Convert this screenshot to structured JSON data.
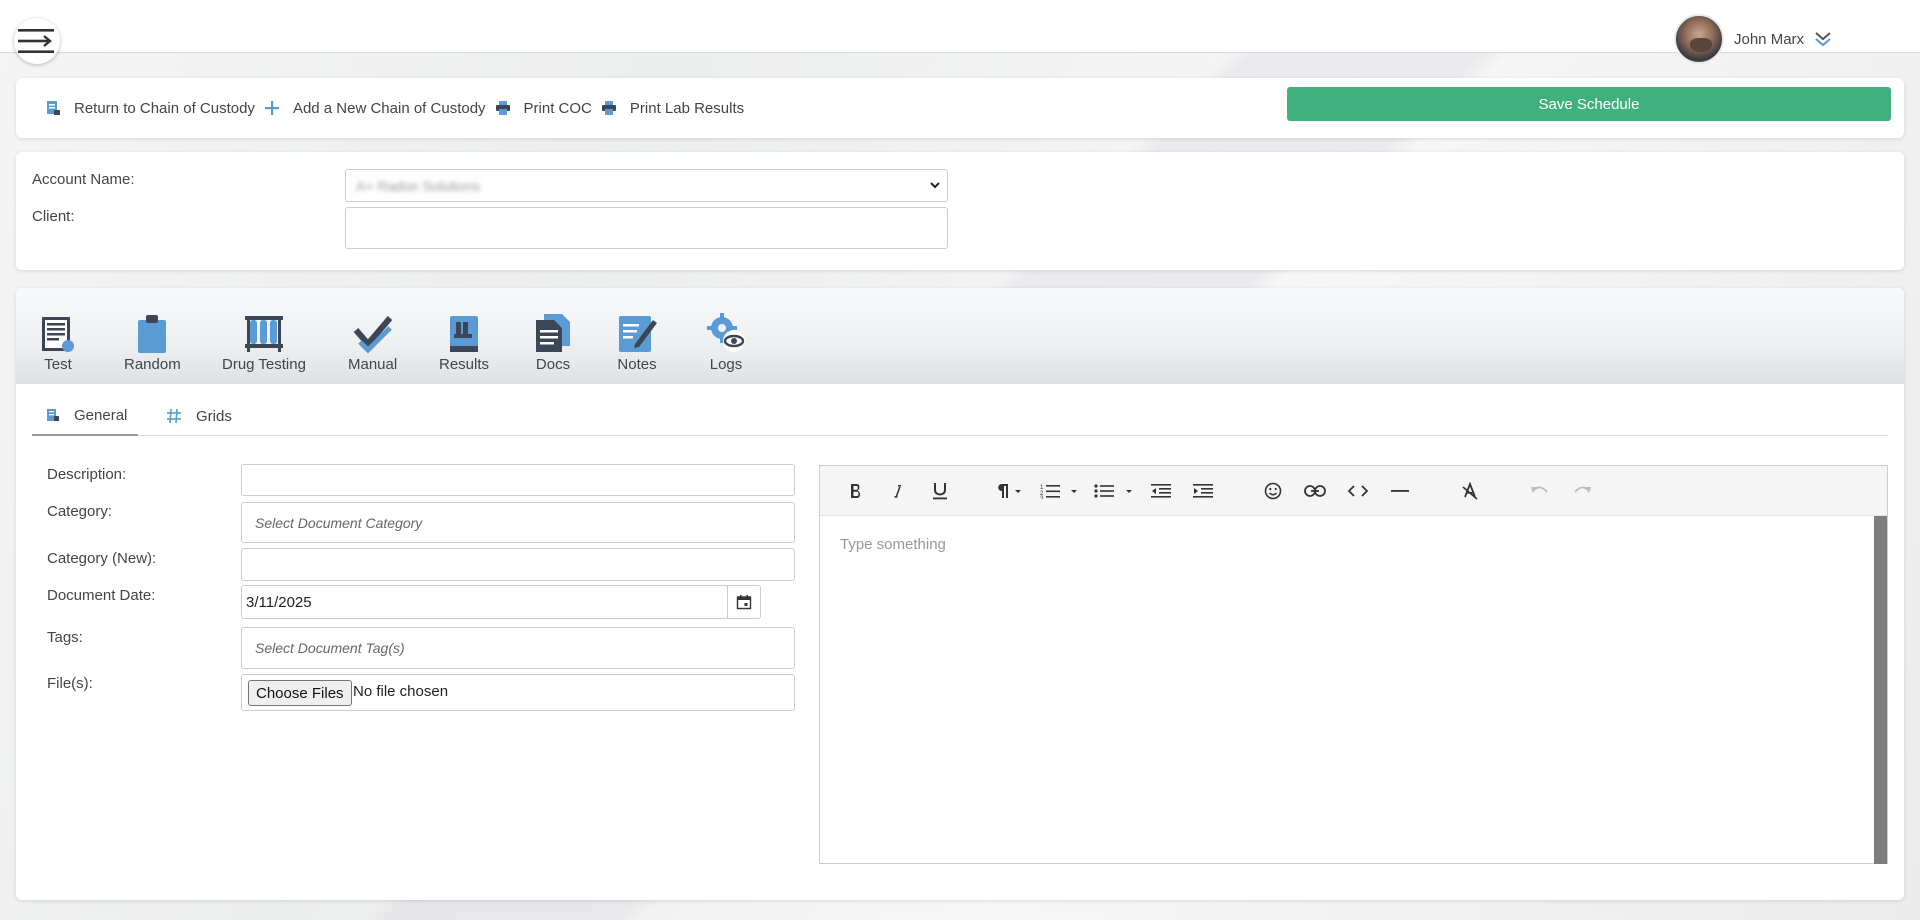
{
  "header": {
    "menu_icon": "hamburger-arrow-icon",
    "user_name": "John Marx",
    "user_menu_icon": "double-chevron-down-icon"
  },
  "toolbar": {
    "actions": [
      {
        "label": "Return to Chain of Custody",
        "icon": "return-doc-icon"
      },
      {
        "label": "Add a New Chain of Custody",
        "icon": "plus-icon"
      },
      {
        "label": "Print COC",
        "icon": "printer-icon"
      },
      {
        "label": "Print Lab Results",
        "icon": "printer-icon"
      }
    ],
    "save_label": "Save Schedule"
  },
  "account": {
    "account_name_label": "Account Name:",
    "account_name_value": "A+ Radon Solutions",
    "client_label": "Client:",
    "client_value": ""
  },
  "main_tabs": [
    {
      "label": "Test",
      "icon": "test-form-icon"
    },
    {
      "label": "Random",
      "icon": "clipboard-icon"
    },
    {
      "label": "Drug Testing",
      "icon": "test-tubes-icon"
    },
    {
      "label": "Manual",
      "icon": "checkmark-icon"
    },
    {
      "label": "Results",
      "icon": "book-icon"
    },
    {
      "label": "Docs",
      "icon": "documents-icon"
    },
    {
      "label": "Notes",
      "icon": "notepad-pencil-icon"
    },
    {
      "label": "Logs",
      "icon": "gear-eye-icon"
    }
  ],
  "sub_tabs": [
    {
      "label": "General",
      "icon": "form-icon"
    },
    {
      "label": "Grids",
      "icon": "hash-icon"
    }
  ],
  "form": {
    "description_label": "Description:",
    "description_value": "",
    "category_label": "Category:",
    "category_placeholder": "Select Document Category",
    "category_new_label": "Category (New):",
    "category_new_value": "",
    "document_date_label": "Document Date:",
    "document_date_value": "3/11/2025",
    "tags_label": "Tags:",
    "tags_placeholder": "Select Document Tag(s)",
    "files_label": "File(s):",
    "choose_files_label": "Choose Files",
    "no_file_text": "No file chosen"
  },
  "editor": {
    "placeholder": "Type something",
    "tools": [
      "bold",
      "italic",
      "underline",
      "paragraph-format",
      "ordered-list",
      "unordered-list",
      "outdent",
      "indent",
      "emoticons",
      "link",
      "code-view",
      "horizontal-line",
      "clear-formatting",
      "undo",
      "redo"
    ]
  },
  "colors": {
    "accent_green": "#40b07e",
    "icon_blue": "#5b9bd5",
    "icon_dark": "#3d4654"
  }
}
